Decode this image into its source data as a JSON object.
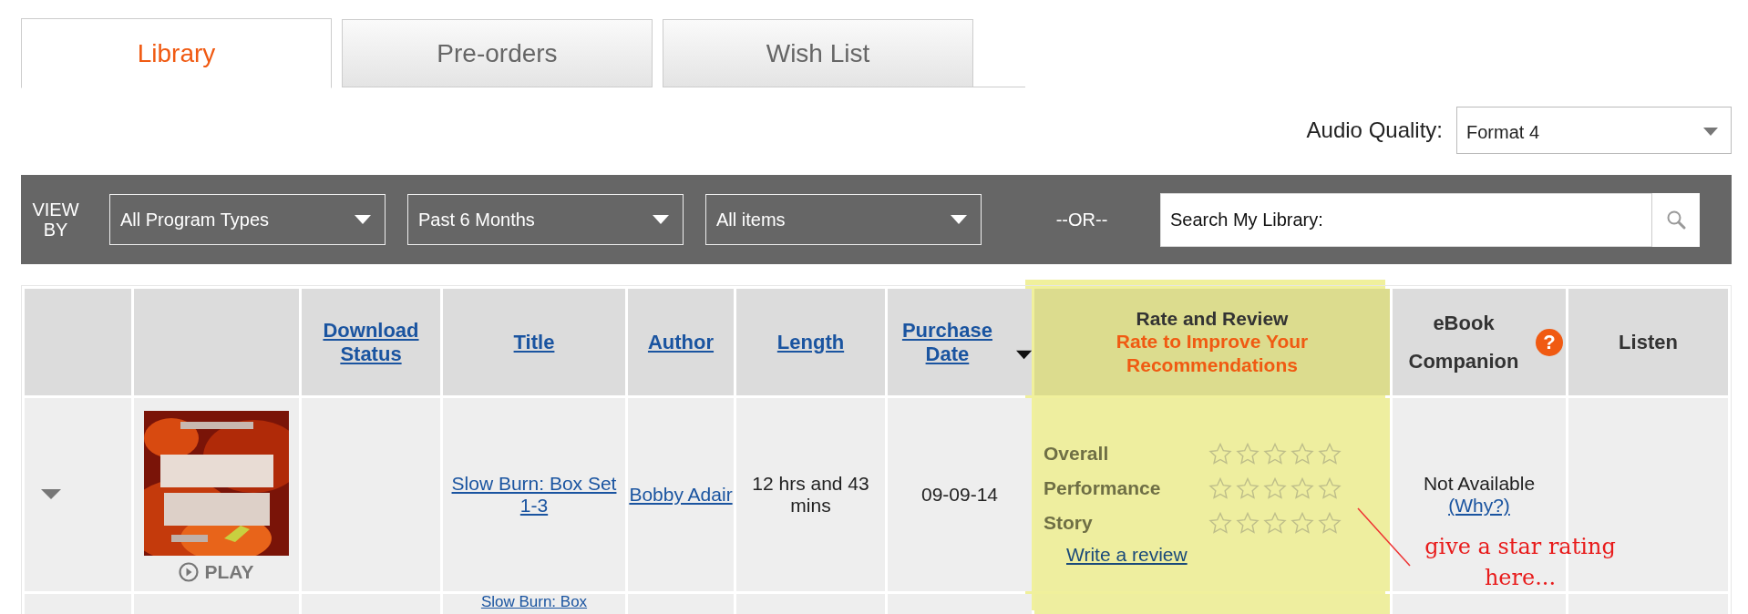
{
  "tabs": [
    {
      "label": "Library",
      "selected": true
    },
    {
      "label": "Pre-orders",
      "selected": false
    },
    {
      "label": "Wish List",
      "selected": false
    }
  ],
  "audio_quality": {
    "label": "Audio Quality:",
    "value": "Format 4"
  },
  "view_by": {
    "label": "VIEW BY",
    "filters": [
      {
        "value": "All Program Types"
      },
      {
        "value": "Past 6 Months"
      },
      {
        "value": "All items"
      }
    ],
    "or_label": "--OR--",
    "search": {
      "placeholder": "Search My Library:"
    }
  },
  "table": {
    "columns": [
      {
        "kind": "blank"
      },
      {
        "kind": "blank"
      },
      {
        "kind": "link",
        "label": "Download Status"
      },
      {
        "kind": "link",
        "label": "Title"
      },
      {
        "kind": "link",
        "label": "Author"
      },
      {
        "kind": "link",
        "label": "Length"
      },
      {
        "kind": "link",
        "label": "Purchase Date",
        "sorted_descending": true
      },
      {
        "kind": "rate",
        "label": "Rate and Review",
        "subtitle": "Rate to Improve Your Recommendations"
      },
      {
        "kind": "help",
        "label": "eBook Companion",
        "help": "?"
      },
      {
        "kind": "plain",
        "label": "Listen"
      }
    ],
    "rows": [
      {
        "expanded": false,
        "play": "PLAY",
        "title": "Slow Burn: Box Set 1-3",
        "author": "Bobby Adair",
        "length": "12 hrs and 43 mins",
        "purchase_date": "09-09-14",
        "ratings": [
          {
            "label": "Overall",
            "stars": 0
          },
          {
            "label": "Performance",
            "stars": 0
          },
          {
            "label": "Story",
            "stars": 0
          }
        ],
        "review_link": "Write a review",
        "ebook": {
          "status": "Not Available",
          "link": "(Why?)"
        }
      },
      {
        "title": "Slow Burn: Box"
      }
    ]
  },
  "annotation": {
    "text": "give a star rating here..."
  }
}
